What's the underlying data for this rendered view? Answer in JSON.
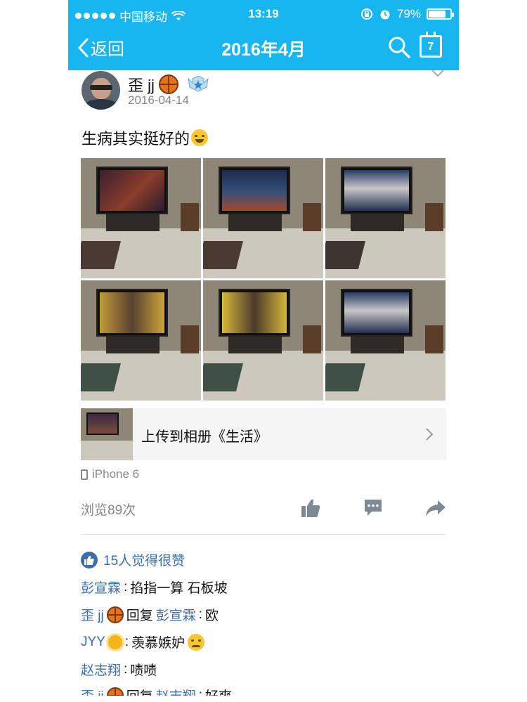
{
  "status_bar": {
    "carrier": "中国移动",
    "time": "13:19",
    "battery": "79%",
    "battery_level": 0.79
  },
  "nav": {
    "back_label": "返回",
    "title": "2016年4月",
    "calendar_day": "7",
    "icons": [
      "chevron-left-icon",
      "search-icon",
      "calendar-icon"
    ]
  },
  "post": {
    "author": "歪 jj",
    "date": "2016-04-14",
    "text": "生病其实挺好的",
    "photos": [
      "photo-1",
      "photo-2",
      "photo-3",
      "photo-4",
      "photo-5",
      "photo-6"
    ],
    "album_label": "上传到相册《生活》",
    "device": "iPhone 6",
    "views": "浏览89次",
    "likes_text": "15人觉得很赞"
  },
  "comments": [
    {
      "name": "彭宣霖",
      "sep": ":",
      "text": "掐指一算 石板坡"
    },
    {
      "name": "歪 jj",
      "reply": "回复",
      "target": "彭宣霖",
      "sep": ":",
      "text": "欧"
    },
    {
      "name": "JYY",
      "sep": ":",
      "text": "羡慕嫉妒"
    },
    {
      "name": "赵志翔",
      "sep": ":",
      "text": "啧啧"
    },
    {
      "name": "歪 jj",
      "reply": "回复",
      "target": "赵志翔",
      "sep": ":",
      "text": "好爽"
    }
  ],
  "colors": {
    "brand_blue": "#17b6f0",
    "link_blue": "#3c6ea8",
    "muted_gray": "#888888"
  }
}
